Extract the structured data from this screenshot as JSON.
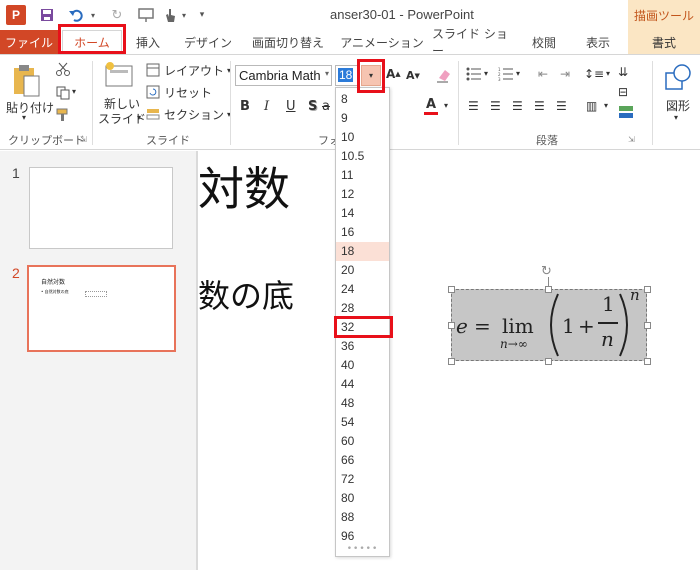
{
  "window": {
    "title": "anser30-01 - PowerPoint",
    "app_icon_letter": "P"
  },
  "tabs": {
    "file": "ファイル",
    "home": "ホーム",
    "insert": "挿入",
    "design": "デザイン",
    "transitions": "画面切り替え",
    "animations": "アニメーション",
    "slideshow": "スライド ショー",
    "review": "校閲",
    "view": "表示",
    "format": "書式",
    "context_header": "描画ツール"
  },
  "ribbon": {
    "clipboard": {
      "paste": "貼り付け",
      "group_label": "クリップボード"
    },
    "slides": {
      "new_slide_line1": "新しい",
      "new_slide_line2": "スライド",
      "layout": "レイアウト",
      "reset": "リセット",
      "section": "セクション",
      "group_label": "スライド"
    },
    "font": {
      "font_name": "Cambria Math",
      "font_size": "18",
      "group_label": "フォ"
    },
    "paragraph": {
      "group_label": "段落"
    },
    "drawing": {
      "shapes": "図形"
    }
  },
  "slides_pane": {
    "slide1_number": "1",
    "slide2_number": "2",
    "slide2_thumb_title": "自然対数",
    "slide2_thumb_bullet": "• 自然対数の底"
  },
  "slide": {
    "title_fragment": "対数",
    "bullet_fragment": "数の底",
    "equation": {
      "lhs": "e",
      "eq": "=",
      "lim": "lim",
      "sub": "n→∞",
      "one": "1",
      "plus": "+",
      "num": "1",
      "den": "n",
      "exp": "n"
    }
  },
  "size_dropdown": {
    "items": [
      "8",
      "9",
      "10",
      "10.5",
      "11",
      "12",
      "14",
      "16",
      "18",
      "20",
      "24",
      "28",
      "32",
      "36",
      "40",
      "44",
      "48",
      "54",
      "60",
      "66",
      "72",
      "80",
      "88",
      "96"
    ],
    "selected": "18",
    "highlighted": "32",
    "grip": "•••••"
  },
  "colors": {
    "accent": "#d24726",
    "highlight_box": "#e8101a",
    "context_tab": "#fbe6c4"
  }
}
